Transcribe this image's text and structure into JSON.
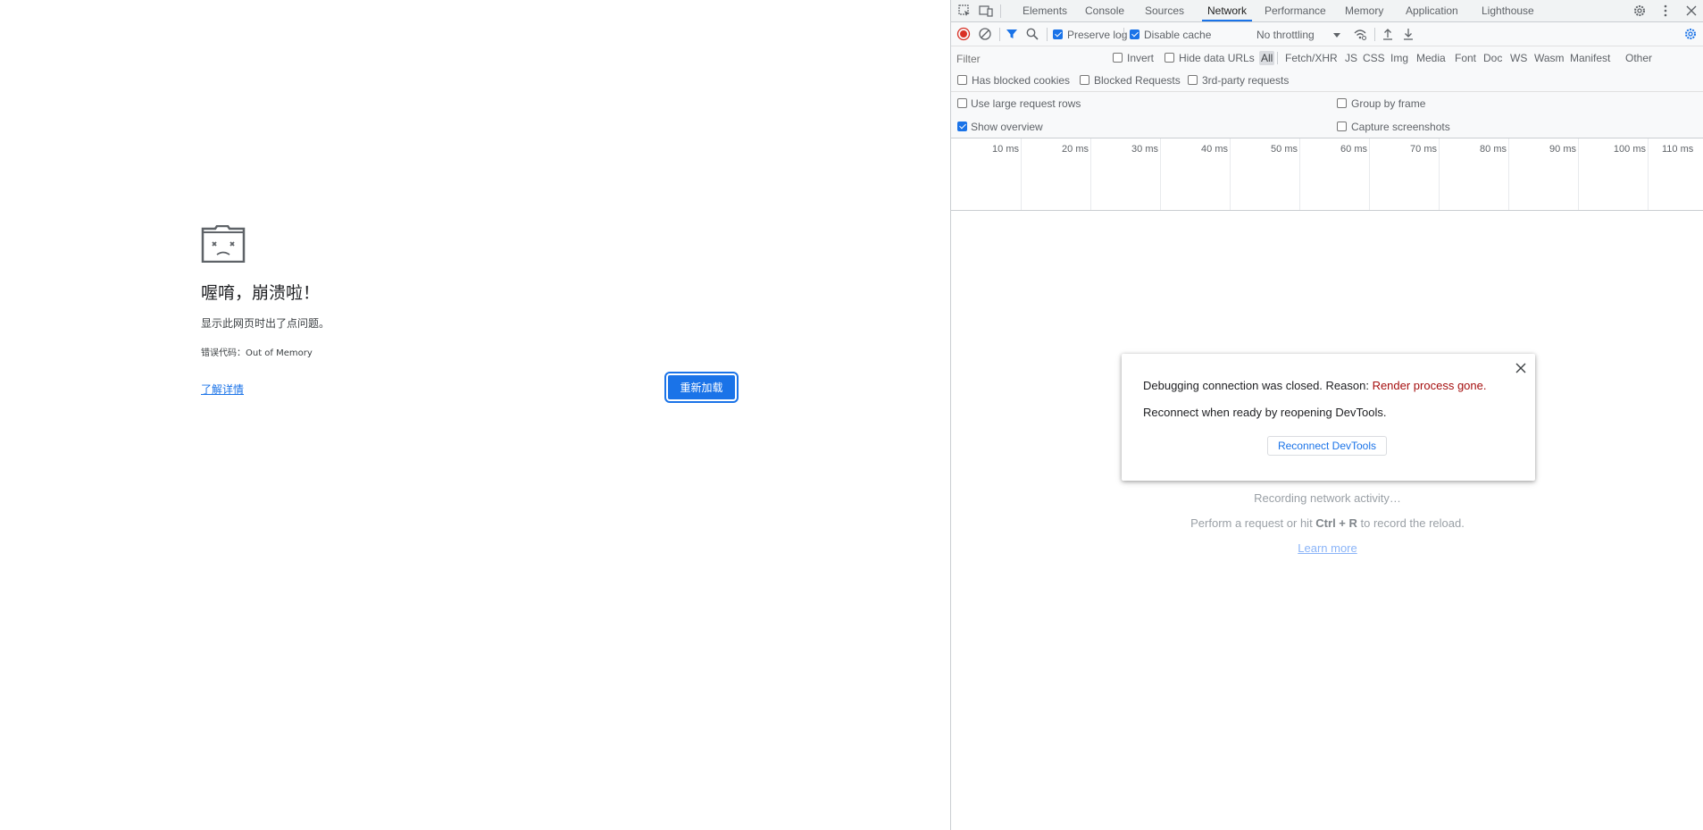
{
  "crash_page": {
    "title": "喔唷，崩溃啦！",
    "description": "显示此网页时出了点问题。",
    "error_code": "错误代码：Out of Memory",
    "learn_more": "了解详情",
    "reload_button": "重新加载",
    "icon": "sad-folder-icon",
    "accent_color": "#1a73e8"
  },
  "devtools": {
    "tabs": [
      "Elements",
      "Console",
      "Sources",
      "Network",
      "Performance",
      "Memory",
      "Application",
      "Lighthouse"
    ],
    "active_tab": "Network",
    "toolbar": {
      "preserve_log": "Preserve log",
      "preserve_log_checked": true,
      "disable_cache": "Disable cache",
      "disable_cache_checked": true,
      "throttling": "No throttling"
    },
    "filter": {
      "placeholder": "Filter",
      "invert": "Invert",
      "hide_data_urls": "Hide data URLs",
      "types": [
        "All",
        "Fetch/XHR",
        "JS",
        "CSS",
        "Img",
        "Media",
        "Font",
        "Doc",
        "WS",
        "Wasm",
        "Manifest",
        "Other"
      ],
      "selected_type": "All",
      "has_blocked_cookies": "Has blocked cookies",
      "blocked_requests": "Blocked Requests",
      "third_party": "3rd-party requests"
    },
    "settings": {
      "large_rows": "Use large request rows",
      "group_by_frame": "Group by frame",
      "show_overview": "Show overview",
      "show_overview_checked": true,
      "capture_screenshots": "Capture screenshots"
    },
    "timeline_ticks": [
      "10 ms",
      "20 ms",
      "30 ms",
      "40 ms",
      "50 ms",
      "60 ms",
      "70 ms",
      "80 ms",
      "90 ms",
      "100 ms",
      "110 ms"
    ],
    "empty_state": {
      "recording": "Recording network activity…",
      "perform_prefix": "Perform a request or hit ",
      "shortcut": "Ctrl + R",
      "perform_suffix": " to record the reload.",
      "learn_more": "Learn more"
    },
    "dialog": {
      "line1_prefix": "Debugging connection was closed. Reason: ",
      "reason": "Render process gone.",
      "line2": "Reconnect when ready by reopening DevTools.",
      "button": "Reconnect DevTools",
      "reason_color": "#a50e0e"
    }
  }
}
